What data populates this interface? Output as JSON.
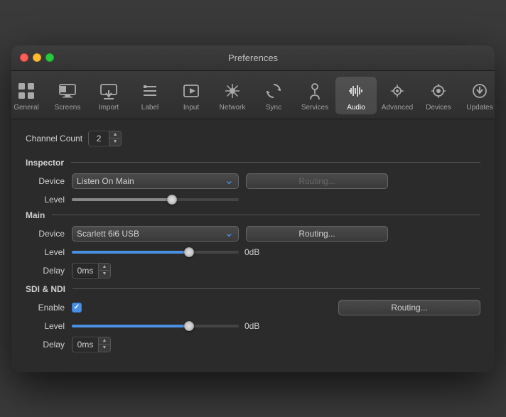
{
  "window": {
    "title": "Preferences"
  },
  "toolbar": {
    "items": [
      {
        "id": "general",
        "label": "General",
        "icon": "⊞"
      },
      {
        "id": "screens",
        "label": "Screens",
        "icon": "🖥"
      },
      {
        "id": "import",
        "label": "Import",
        "icon": "⬇"
      },
      {
        "id": "label",
        "label": "Label",
        "icon": "≡"
      },
      {
        "id": "input",
        "label": "Input",
        "icon": "🎬"
      },
      {
        "id": "network",
        "label": "Network",
        "icon": "✦"
      },
      {
        "id": "sync",
        "label": "Sync",
        "icon": "↻"
      },
      {
        "id": "services",
        "label": "Services",
        "icon": "🔑"
      },
      {
        "id": "audio",
        "label": "Audio",
        "icon": "♫"
      },
      {
        "id": "advanced",
        "label": "Advanced",
        "icon": "⚙"
      },
      {
        "id": "devices",
        "label": "Devices",
        "icon": "📡"
      },
      {
        "id": "updates",
        "label": "Updates",
        "icon": "⬇"
      }
    ]
  },
  "content": {
    "channel_count_label": "Channel Count",
    "channel_count_value": "2",
    "inspector_section": "Inspector",
    "inspector_device_label": "Device",
    "inspector_device_value": "Listen On Main",
    "inspector_routing_label": "Routing...",
    "inspector_level_label": "Level",
    "inspector_level_value": "",
    "inspector_level_percent": 60,
    "main_section": "Main",
    "main_device_label": "Device",
    "main_device_value": "Scarlett 6i6 USB",
    "main_routing_label": "Routing...",
    "main_level_label": "Level",
    "main_level_value": "0dB",
    "main_level_percent": 70,
    "main_delay_label": "Delay",
    "main_delay_value": "0ms",
    "sdi_ndi_section": "SDI & NDI",
    "sdi_enable_label": "Enable",
    "sdi_routing_label": "Routing...",
    "sdi_level_label": "Level",
    "sdi_level_value": "0dB",
    "sdi_level_percent": 70,
    "sdi_delay_label": "Delay",
    "sdi_delay_value": "0ms"
  }
}
